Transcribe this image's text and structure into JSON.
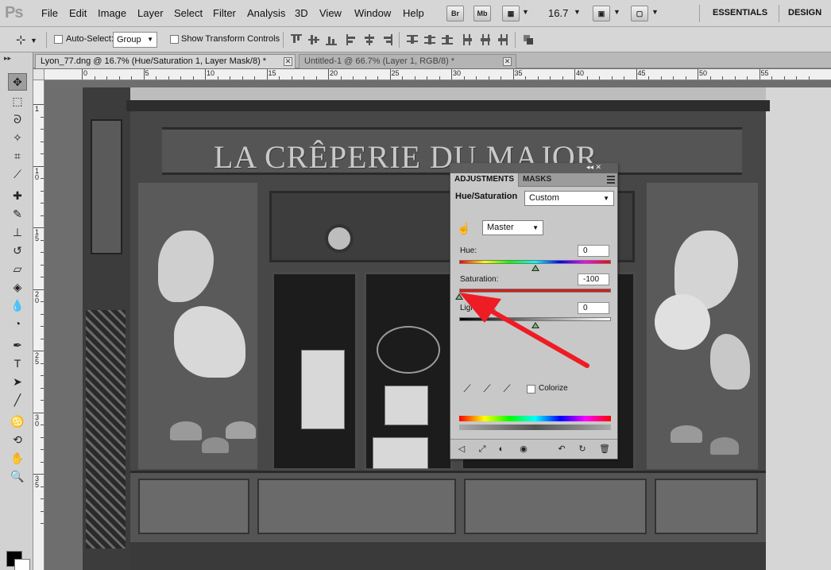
{
  "app": {
    "logo": "Ps",
    "menu": [
      "File",
      "Edit",
      "Image",
      "Layer",
      "Select",
      "Filter",
      "Analysis",
      "3D",
      "View",
      "Window",
      "Help"
    ],
    "bridge_button": "Br",
    "minibridge_button": "Mb",
    "zoom": "16.7",
    "workspaces": [
      "ESSENTIALS",
      "DESIGN"
    ]
  },
  "options": {
    "auto_select_label": "Auto-Select:",
    "auto_select_value": "Group",
    "transform_label": "Show Transform Controls"
  },
  "panel": {
    "collapse_glyph": "▸▸"
  },
  "tabs": [
    {
      "label": "Lyon_77.dng @ 16.7% (Hue/Saturation 1, Layer Mask/8) *",
      "close": "✕"
    },
    {
      "label": "Untitled-1 @ 66.7% (Layer 1, RGB/8) *",
      "close": "✕"
    }
  ],
  "ruler": {
    "h_labels": [
      "0",
      "5",
      "10",
      "15",
      "20",
      "25",
      "30",
      "35",
      "40",
      "45",
      "50",
      "55"
    ],
    "v_labels": [
      "1",
      "1 0",
      "1 5",
      "2 0",
      "2 5",
      "3 0",
      "3 5"
    ]
  },
  "photo": {
    "sign_text": "LA CRÊPERIE DU MAJOR"
  },
  "adjustments": {
    "tab_adjustments": "ADJUSTMENTS",
    "tab_masks": "MASKS",
    "collapse_glyphs": "◂◂ ✕",
    "type_label": "Hue/Saturation",
    "preset": "Custom",
    "channel": "Master",
    "hue": {
      "label": "Hue:",
      "value": "0",
      "position": 0.5
    },
    "saturation": {
      "label": "Saturation:",
      "value": "-100",
      "position": 0.0
    },
    "lightness": {
      "label": "Lightness:",
      "value": "0",
      "position": 0.5
    },
    "colorize_label": "Colorize"
  },
  "annotation_color": "#ee1c24"
}
